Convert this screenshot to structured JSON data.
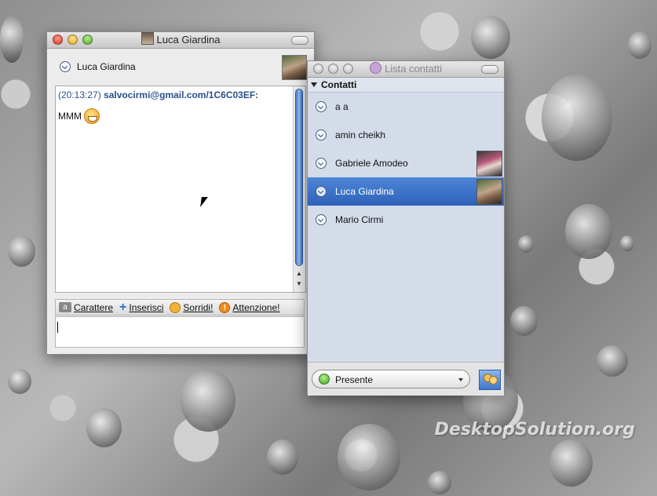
{
  "chat_window": {
    "title": "Luca Giardina",
    "contact_name": "Luca Giardina",
    "message": {
      "time": "(20:13:27)",
      "sender": "salvocirmi@gmail.com/1C6C03EF:",
      "text": "MMM"
    },
    "toolbar": {
      "font_label": "Carattere",
      "insert_label": "Inserisci",
      "smile_label": "Sorridi!",
      "attention_label": "Attenzione!"
    },
    "input_value": ""
  },
  "contact_window": {
    "title": "Lista contatti",
    "group_name": "Contatti",
    "contacts": [
      {
        "name": "a a"
      },
      {
        "name": "amin cheikh"
      },
      {
        "name": "Gabriele Amodeo"
      },
      {
        "name": "Luca Giardina"
      },
      {
        "name": "Mario Cirmi"
      }
    ],
    "status": "Presente"
  },
  "watermark": "DesktopSolution.org"
}
